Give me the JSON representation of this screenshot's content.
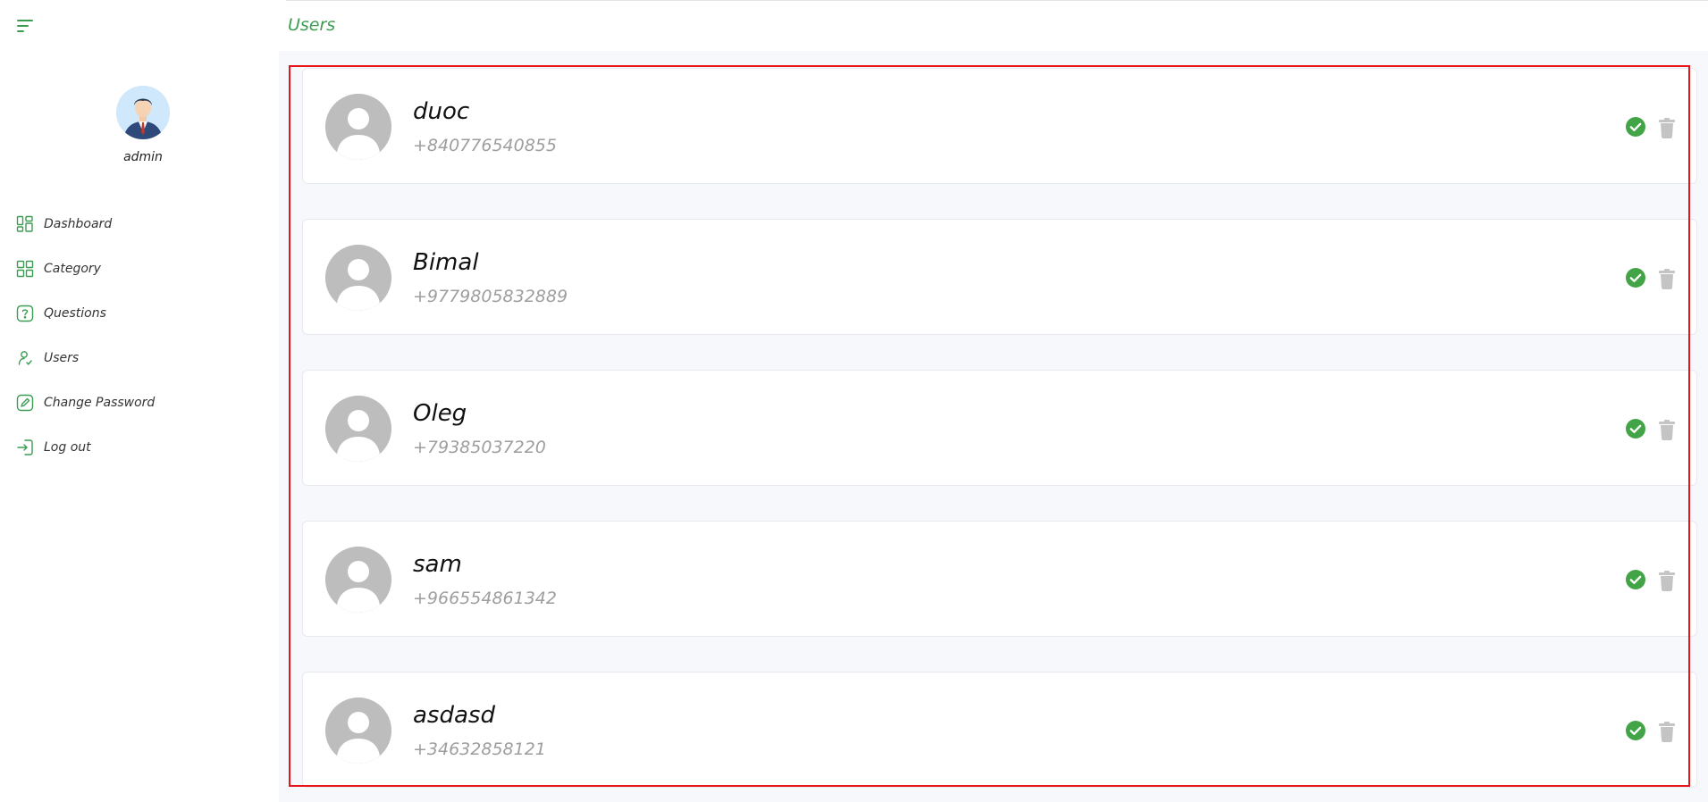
{
  "header": {
    "title": "Users"
  },
  "sidebar": {
    "profile": {
      "name": "admin"
    },
    "items": [
      {
        "label": "Dashboard",
        "icon": "dashboard-icon"
      },
      {
        "label": "Category",
        "icon": "category-icon"
      },
      {
        "label": "Questions",
        "icon": "question-icon"
      },
      {
        "label": "Users",
        "icon": "user-icon"
      },
      {
        "label": "Change Password",
        "icon": "edit-password-icon"
      },
      {
        "label": "Log out",
        "icon": "logout-icon"
      }
    ]
  },
  "users": [
    {
      "name": "duoc",
      "phone": "+840776540855"
    },
    {
      "name": "Bimal",
      "phone": "+9779805832889"
    },
    {
      "name": "Oleg",
      "phone": "+79385037220"
    },
    {
      "name": "sam",
      "phone": "+966554861342"
    },
    {
      "name": "asdasd",
      "phone": "+34632858121"
    }
  ],
  "colors": {
    "accent": "#3a9d51",
    "verify": "#43a447",
    "delete": "#c4c4c4",
    "highlight": "#e8141c",
    "content_bg": "#f6f8fb"
  }
}
